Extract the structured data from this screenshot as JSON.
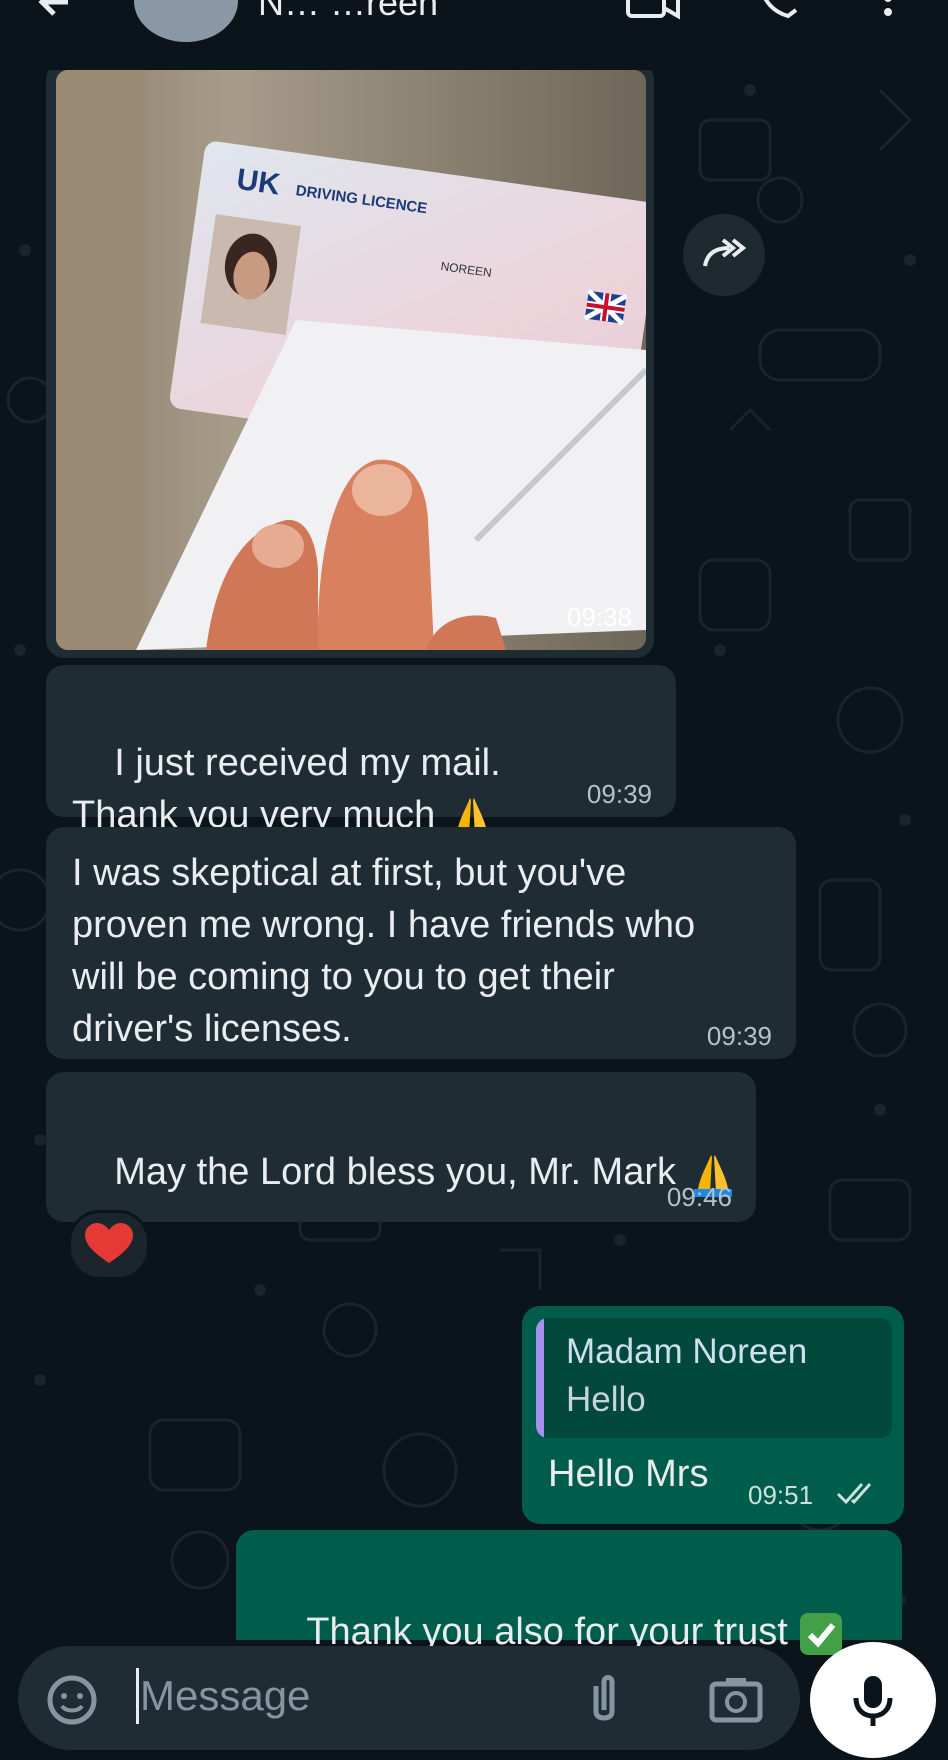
{
  "header": {
    "contact_name": "N… …reen"
  },
  "messages": [
    {
      "type": "image",
      "direction": "in",
      "time": "09:38",
      "photo_text": [
        "UK",
        "DRIVING LICENCE",
        "NOREEN"
      ]
    },
    {
      "type": "text",
      "direction": "in",
      "text": "I just received my mail.\nThank you very much",
      "emoji": "folded-hands",
      "time": "09:39"
    },
    {
      "type": "text",
      "direction": "in",
      "text": "I was skeptical at first, but you've\nproven me wrong. I have friends who\nwill be coming to you to get their\ndriver's licenses.",
      "time": "09:39"
    },
    {
      "type": "text",
      "direction": "in",
      "text": "May the Lord bless you, Mr. Mark",
      "emoji": "folded-hands",
      "time": "09:46",
      "reaction": "red-heart"
    },
    {
      "type": "text",
      "direction": "out",
      "quote": {
        "author": "Madam Noreen",
        "text": "Hello"
      },
      "text": "Hello Mrs",
      "time": "09:51",
      "status": "read-double-check"
    },
    {
      "type": "text",
      "direction": "out",
      "text": "Thank you also for your trust",
      "emoji": "check-mark-button"
    }
  ],
  "composer": {
    "placeholder": "Message",
    "icons": [
      "emoji-sticker-icon",
      "attach-icon",
      "camera-icon",
      "mic-icon"
    ]
  },
  "colors": {
    "background": "#0b141a",
    "incoming_bubble": "#202c33",
    "outgoing_bubble": "#005c4b",
    "quote_bar": "#a791f0"
  }
}
